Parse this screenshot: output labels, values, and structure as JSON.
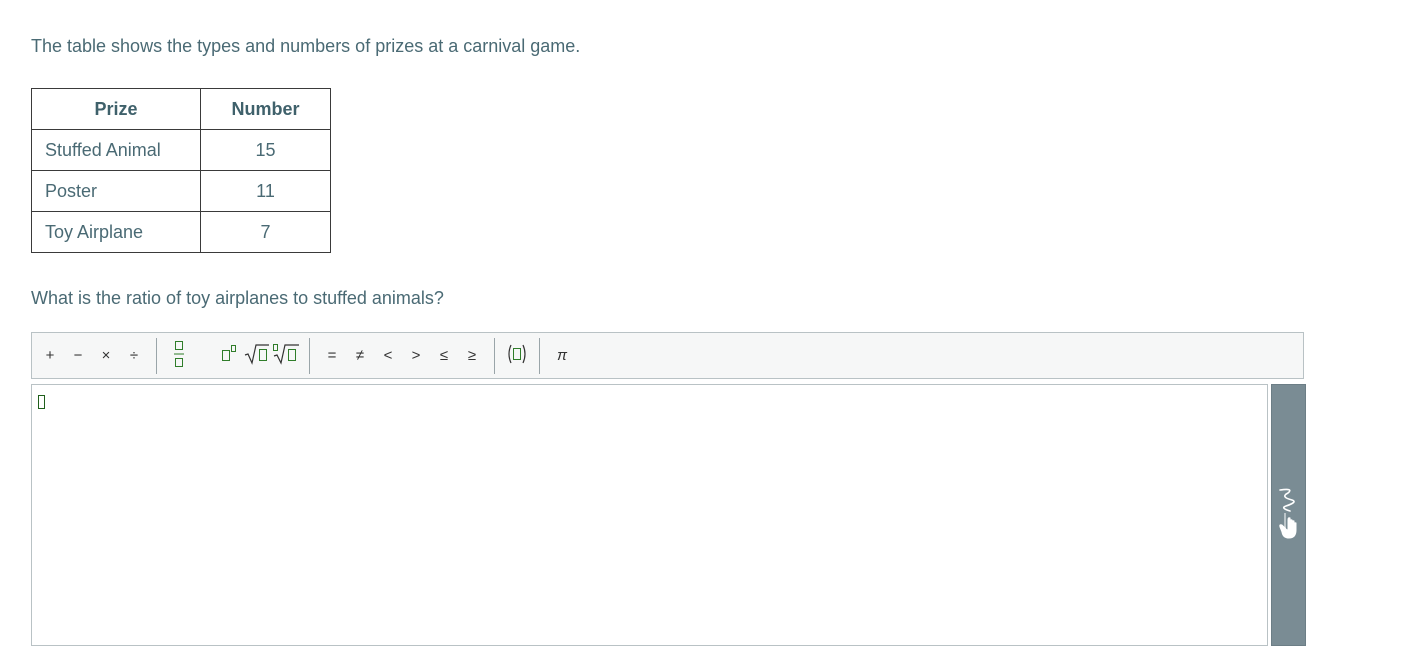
{
  "prompt_text": "The table shows the types and numbers of prizes at a carnival game.",
  "table": {
    "headers": [
      "Prize",
      "Number"
    ],
    "rows": [
      [
        "Stuffed Animal",
        "15"
      ],
      [
        "Poster",
        "11"
      ],
      [
        "Toy Airplane",
        "7"
      ]
    ]
  },
  "question_text": "What is the ratio of toy airplanes to stuffed animals?",
  "toolbar": {
    "arithmetic": [
      "+",
      "−",
      "×",
      "÷"
    ],
    "structures": [
      "fraction",
      "exponent",
      "square-root",
      "nth-root"
    ],
    "relations": [
      "=",
      "≠",
      "<",
      ">",
      "≤",
      "≥"
    ],
    "parentheses": "(▯)",
    "pi": "π"
  },
  "editor": {
    "value": ""
  },
  "side_panel": {
    "icon": "handwriting-icon"
  },
  "colors": {
    "text": "#4a6a74",
    "accent_green": "#2f7d2a",
    "side_panel": "#7a8c94",
    "toolbar_bg": "#f6f7f7"
  }
}
